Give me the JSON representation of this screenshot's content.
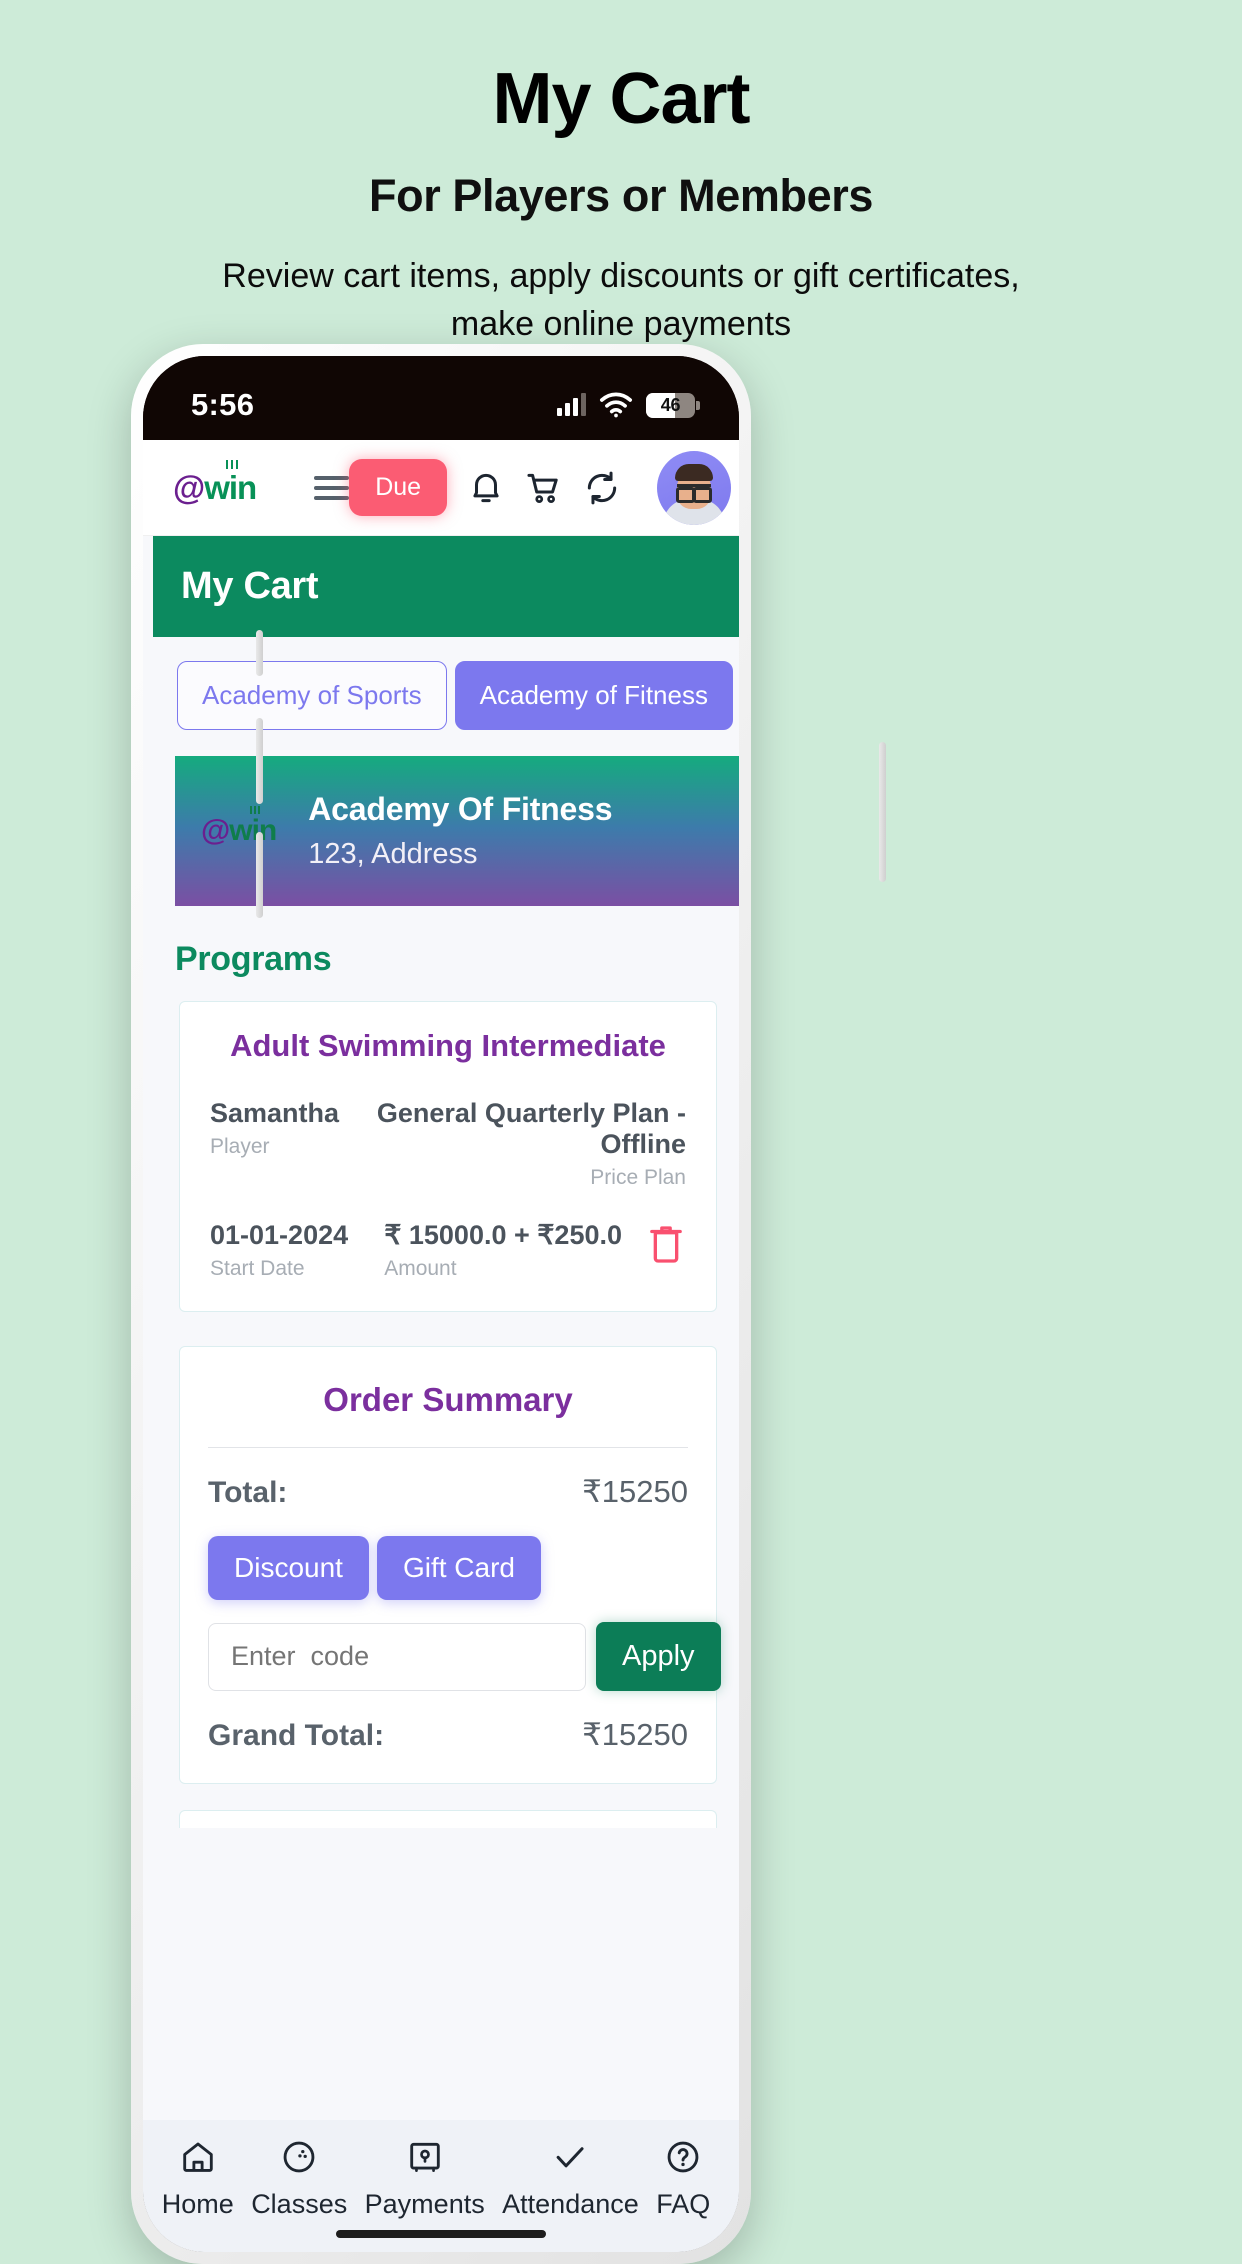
{
  "promo": {
    "title": "My Cart",
    "subtitle": "For Players or Members",
    "description": "Review cart items, apply discounts or gift certificates, make online payments"
  },
  "status_bar": {
    "time": "5:56",
    "battery_level": "46",
    "signal_icon": "signal-bars-icon",
    "wifi_icon": "wifi-icon"
  },
  "app_header": {
    "logo_at": "@",
    "logo_win": "win",
    "menu_icon": "hamburger-menu-icon",
    "due_label": "Due",
    "bell_icon": "bell-icon",
    "cart_icon": "cart-icon",
    "refresh_icon": "refresh-icon",
    "avatar_icon": "user-avatar"
  },
  "page": {
    "title": "My Cart"
  },
  "tabs": [
    {
      "label": "Academy of Sports",
      "active": false
    },
    {
      "label": "Academy of Fitness",
      "active": true
    }
  ],
  "academy_banner": {
    "logo_at": "@",
    "logo_win": "win",
    "name": "Academy Of Fitness",
    "address": "123, Address"
  },
  "programs": {
    "section_title": "Programs",
    "items": [
      {
        "title": "Adult Swimming Intermediate",
        "player_value": "Samantha",
        "player_label": "Player",
        "plan_value": "General Quarterly Plan - Offline",
        "plan_label": "Price Plan",
        "start_value": "01-01-2024",
        "start_label": "Start Date",
        "amount_value": "₹ 15000.0 + ₹250.0",
        "amount_label": "Amount",
        "delete_icon": "trash-icon"
      }
    ]
  },
  "order_summary": {
    "title": "Order Summary",
    "total_label": "Total:",
    "total_value": "₹15250",
    "discount_label": "Discount",
    "gift_card_label": "Gift Card",
    "code_placeholder": "Enter  code",
    "code_value": "",
    "apply_label": "Apply",
    "grand_total_label": "Grand Total:",
    "grand_total_value": "₹15250"
  },
  "bottom_nav": [
    {
      "label": "Home",
      "icon": "home-icon"
    },
    {
      "label": "Classes",
      "icon": "ball-icon"
    },
    {
      "label": "Payments",
      "icon": "safe-icon"
    },
    {
      "label": "Attendance",
      "icon": "check-icon"
    },
    {
      "label": "FAQ",
      "icon": "question-circle-icon"
    }
  ],
  "colors": {
    "page_background": "#cdebd8",
    "brand_green": "#0c8a5f",
    "brand_purple": "#7b2f9e",
    "accent_indigo": "#7c78ee",
    "danger_pink": "#fb5c73"
  }
}
